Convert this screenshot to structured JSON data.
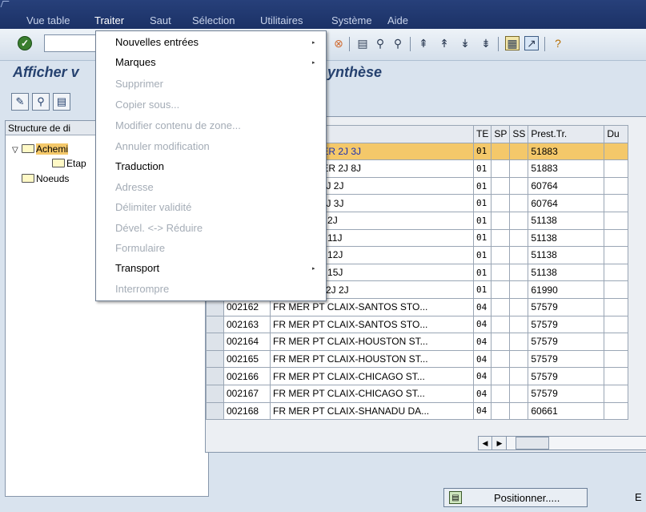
{
  "menubar": {
    "items": [
      "Vue table",
      "Traiter",
      "Saut",
      "Sélection",
      "Utilitaires",
      "Système",
      "Aide"
    ],
    "active": "Traiter"
  },
  "title": {
    "left": "Afficher v",
    "right": "ynthèse"
  },
  "dropdown": {
    "items": [
      {
        "label": "Nouvelles entrées",
        "enabled": true,
        "submenu": true
      },
      {
        "label": "Marques",
        "enabled": true,
        "submenu": true
      },
      {
        "label": "Supprimer",
        "enabled": false,
        "submenu": false
      },
      {
        "label": "Copier sous...",
        "enabled": false,
        "submenu": false
      },
      {
        "label": "Modifier contenu de zone...",
        "enabled": false,
        "submenu": false
      },
      {
        "label": "Annuler modification",
        "enabled": false,
        "submenu": false
      },
      {
        "label": "Traduction",
        "enabled": true,
        "submenu": false
      },
      {
        "label": "Adresse",
        "enabled": false,
        "submenu": false
      },
      {
        "label": "Délimiter validité",
        "enabled": false,
        "submenu": false
      },
      {
        "label": "Dével. <-> Réduire",
        "enabled": false,
        "submenu": false
      },
      {
        "label": "Formulaire",
        "enabled": false,
        "submenu": false
      },
      {
        "label": "Transport",
        "enabled": true,
        "submenu": true
      },
      {
        "label": "Interrompre",
        "enabled": false,
        "submenu": false
      }
    ]
  },
  "tree": {
    "header": "Structure de di",
    "nodes": [
      {
        "label": "Achemi",
        "selected": true,
        "expanded": true
      },
      {
        "label": "Etap",
        "selected": false,
        "expanded": false
      },
      {
        "label": "Noeuds",
        "selected": false,
        "expanded": false
      }
    ]
  },
  "table": {
    "columns": [
      "",
      "ion",
      "TE",
      "SP",
      "SS",
      "Prest.Tr.",
      "Du"
    ],
    "rows": [
      {
        "id": "",
        "desc": "E SCHENKER 2J 3J",
        "te": "01",
        "sp": "",
        "ss": "",
        "prest": "51883",
        "highlight": true
      },
      {
        "id": "",
        "desc": "E SCHENKER 2J 8J",
        "te": "01",
        "sp": "",
        "ss": "",
        "prest": "51883",
        "highlight": false
      },
      {
        "id": "",
        "desc": "E TRAVEL 2J 2J",
        "te": "01",
        "sp": "",
        "ss": "",
        "prest": "60764",
        "highlight": false
      },
      {
        "id": "",
        "desc": "E TRAVEL 2J 3J",
        "te": "01",
        "sp": "",
        "ss": "",
        "prest": "60764",
        "highlight": false
      },
      {
        "id": "",
        "desc": "DANZAS 2J 2J",
        "te": "01",
        "sp": "",
        "ss": "",
        "prest": "51138",
        "highlight": false
      },
      {
        "id": "",
        "desc": "DANZAS 2J 11J",
        "te": "01",
        "sp": "",
        "ss": "",
        "prest": "51138",
        "highlight": false
      },
      {
        "id": "",
        "desc": "DANZAS 2J 12J",
        "te": "01",
        "sp": "",
        "ss": "",
        "prest": "51138",
        "highlight": false
      },
      {
        "id": "",
        "desc": "DANZAS 2J 15J",
        "te": "01",
        "sp": "",
        "ss": "",
        "prest": "51138",
        "highlight": false
      },
      {
        "id": "",
        "desc": "TRAFICTIR 2J 2J",
        "te": "01",
        "sp": "",
        "ss": "",
        "prest": "61990",
        "highlight": false
      },
      {
        "id": "002162",
        "desc": "FR MER PT CLAIX-SANTOS STO...",
        "te": "04",
        "sp": "",
        "ss": "",
        "prest": "57579",
        "highlight": false
      },
      {
        "id": "002163",
        "desc": "FR MER PT CLAIX-SANTOS STO...",
        "te": "04",
        "sp": "",
        "ss": "",
        "prest": "57579",
        "highlight": false
      },
      {
        "id": "002164",
        "desc": "FR MER PT CLAIX-HOUSTON ST...",
        "te": "04",
        "sp": "",
        "ss": "",
        "prest": "57579",
        "highlight": false
      },
      {
        "id": "002165",
        "desc": "FR MER PT CLAIX-HOUSTON ST...",
        "te": "04",
        "sp": "",
        "ss": "",
        "prest": "57579",
        "highlight": false
      },
      {
        "id": "002166",
        "desc": "FR MER PT CLAIX-CHICAGO ST...",
        "te": "04",
        "sp": "",
        "ss": "",
        "prest": "57579",
        "highlight": false
      },
      {
        "id": "002167",
        "desc": "FR MER PT CLAIX-CHICAGO ST...",
        "te": "04",
        "sp": "",
        "ss": "",
        "prest": "57579",
        "highlight": false
      },
      {
        "id": "002168",
        "desc": "FR MER PT CLAIX-SHANADU DA...",
        "te": "04",
        "sp": "",
        "ss": "",
        "prest": "60661",
        "highlight": false
      }
    ]
  },
  "bottom": {
    "position_button": "Positionner.....",
    "right_letter": "E"
  },
  "icons": {
    "ok": "checkmark-icon",
    "save": "save-icon",
    "find": "find-icon",
    "find_next": "find-next-icon",
    "help": "help-icon"
  },
  "colors": {
    "menubar": "#1b3166",
    "selection": "#f4c86a",
    "highlight_text": "#1a2fb0",
    "title": "#25416f"
  }
}
